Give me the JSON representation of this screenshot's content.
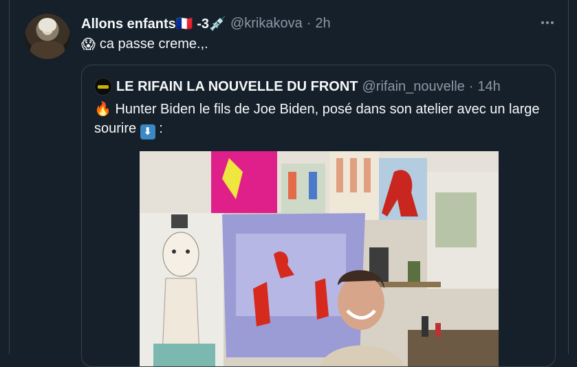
{
  "tweet": {
    "display_name": "Allons enfants🇫🇷 -3💉",
    "handle": "@krikakova",
    "separator": "·",
    "time": "2h",
    "emoji": "😱",
    "text": "ca passe creme.,."
  },
  "quoted_tweet": {
    "display_name": "LE RIFAIN LA NOUVELLE DU FRONT",
    "handle": "@rifain_nouvelle",
    "separator": "·",
    "time": "14h",
    "lead_emoji": "🔥",
    "text": "Hunter Biden le fils de Joe Biden, posé dans son atelier avec un large sourire",
    "arrow_glyph": "⬇",
    "trailing": ":"
  },
  "icons": [
    "more-options-icon",
    "user-avatar",
    "quoted-user-avatar",
    "down-arrow-icon"
  ],
  "colors": {
    "background": "#15202b",
    "border": "#38444d",
    "primary_text": "#f7f9f9",
    "secondary_text": "#8b98a5"
  }
}
